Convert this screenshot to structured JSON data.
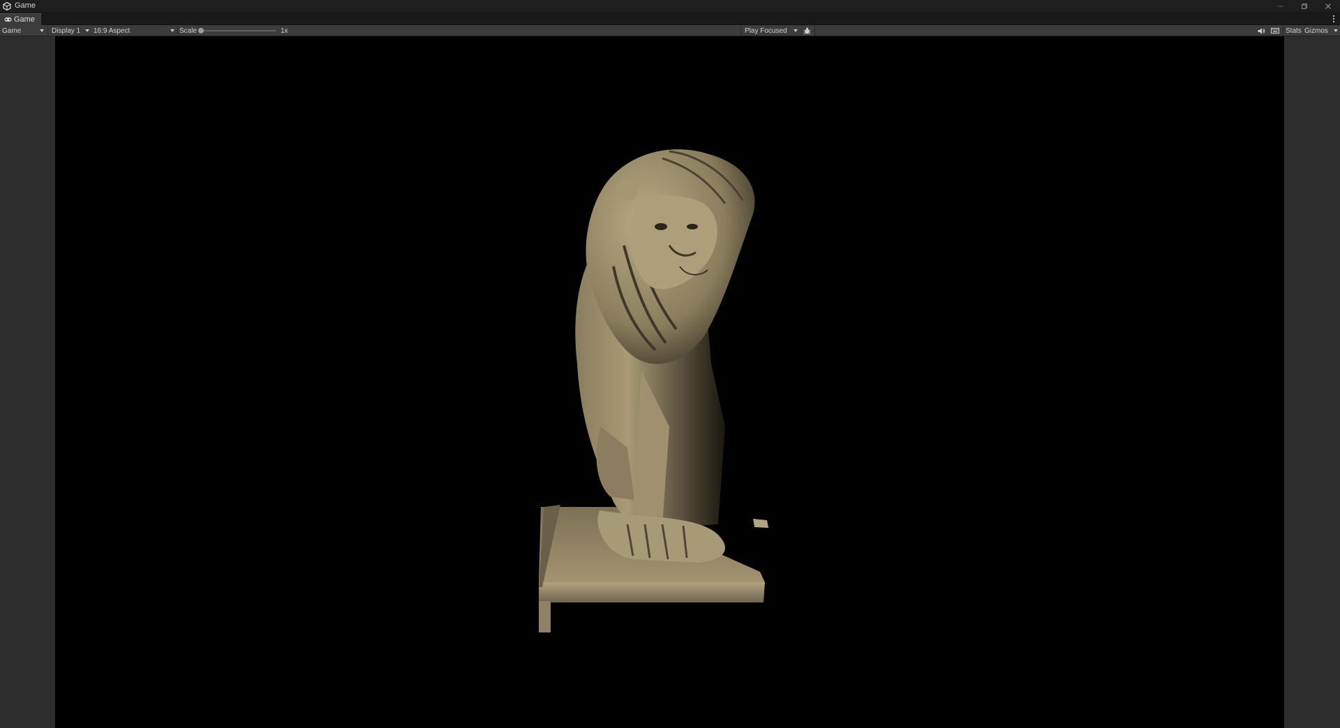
{
  "window": {
    "title": "Game"
  },
  "tab": {
    "label": "Game"
  },
  "toolbar": {
    "view_dropdown": "Game",
    "display_dropdown": "Display 1",
    "aspect_dropdown": "16:9 Aspect",
    "scale_label": "Scale",
    "scale_value": "1x",
    "scale_slider_fraction": 0.0,
    "play_mode_dropdown": "Play Focused",
    "stats_label": "Stats",
    "gizmos_label": "Gizmos"
  },
  "icons": {
    "app": "unity-logo-icon",
    "tab": "gamepad-icon",
    "debug": "bug-icon",
    "audio": "speaker-icon",
    "shortcuts": "keyboard-icon"
  },
  "colors": {
    "statue_light": "#b7a882",
    "statue_mid": "#8c7f60",
    "statue_dark": "#4a4332",
    "game_background": "#000000"
  }
}
